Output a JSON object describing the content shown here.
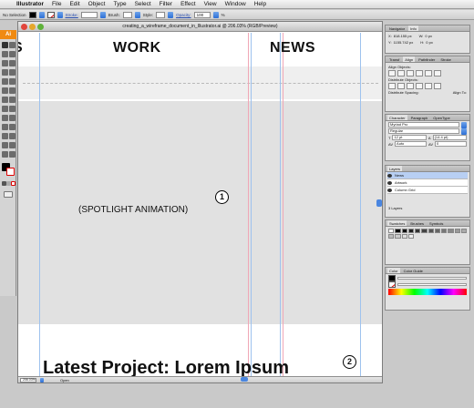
{
  "menubar": {
    "app_name": "Illustrator",
    "items": [
      "File",
      "Edit",
      "Object",
      "Type",
      "Select",
      "Filter",
      "Effect",
      "View",
      "Window",
      "Help"
    ]
  },
  "controlbar": {
    "selection": "No Selection",
    "stroke_label": "Stroke:",
    "brush_label": "Brush:",
    "style_label": "Style:",
    "opacity_label": "Opacity:",
    "opacity_value": "100",
    "opacity_unit": "%"
  },
  "tools": {
    "badge": "Ai"
  },
  "document": {
    "title": "creating_a_wireframe_document_in_Illustrator.ai @ 206.03% (RGB/Preview)",
    "nav_left_fragment": "S",
    "nav_work": "WORK",
    "nav_news": "NEWS",
    "spotlight_label": "(SPOTLIGHT ANIMATION)",
    "marker_1": "1",
    "marker_2": "2",
    "latest_project": "Latest Project: Lorem Ipsum",
    "zoom": "206.03%",
    "status_mode": "Open"
  },
  "panels": {
    "navigator": {
      "tabs": [
        "Navigator",
        "Info"
      ],
      "x_value": "818.155 px",
      "y_value": "1155.742 px",
      "w_value": "0 px",
      "h_value": "0 px"
    },
    "align": {
      "tabs": [
        "Transf",
        "Align",
        "Pathfinder",
        "Stroke"
      ],
      "align_objects": "Align Objects:",
      "distribute_objects": "Distribute Objects:",
      "distribute_spacing": "Distribute Spacing:",
      "align_to": "Align To:"
    },
    "character": {
      "tabs": [
        "Character",
        "Paragraph",
        "OpenType"
      ],
      "font": "Myriad Pro",
      "style": "Regular",
      "size": "12 pt",
      "leading": "(14.4 pt)",
      "kerning": "Auto",
      "tracking": "0"
    },
    "layers": {
      "tabs": [
        "Layers"
      ],
      "rows": [
        "News",
        "Artwork",
        "Column Grid"
      ],
      "count": "3 Layers"
    },
    "swatches": {
      "tabs": [
        "Swatches",
        "Brushes",
        "Symbols"
      ]
    },
    "color": {
      "tabs": [
        "Color",
        "Color Guide"
      ]
    }
  },
  "colors": {
    "guide_blue": "#9ec2ee",
    "guide_pink": "#f0a7b6",
    "illustrator_orange": "#f08a12"
  }
}
